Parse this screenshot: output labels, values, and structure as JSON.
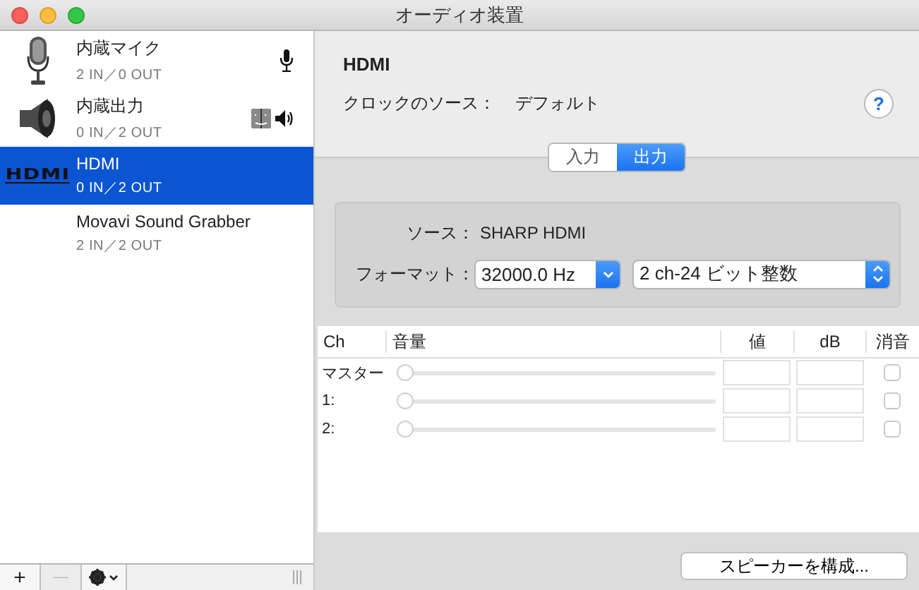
{
  "window": {
    "title": "オーディオ装置"
  },
  "devices": [
    {
      "kind": "microphone",
      "name": "内蔵マイク",
      "io": "2 IN／0 OUT",
      "selected": false,
      "default_input": true,
      "default_output": false,
      "system_output": false
    },
    {
      "kind": "speaker",
      "name": "内蔵出力",
      "io": "0 IN／2 OUT",
      "selected": false,
      "default_input": false,
      "default_output": true,
      "system_output": true
    },
    {
      "kind": "hdmi",
      "logo": "HDMI",
      "name": "HDMI",
      "io": "0 IN／2 OUT",
      "selected": true,
      "default_input": false,
      "default_output": false,
      "system_output": false
    },
    {
      "kind": "plain",
      "name": "Movavi Sound Grabber",
      "io": "2 IN／2 OUT",
      "selected": false,
      "default_input": false,
      "default_output": false,
      "system_output": false
    }
  ],
  "sidebar_toolbar": {
    "add": "+",
    "remove": "—",
    "remove_disabled": true
  },
  "detail": {
    "title": "HDMI",
    "clock_label": "クロックのソース：",
    "clock_value": "デフォルト",
    "help": "?"
  },
  "tabs": [
    {
      "label": "入力",
      "selected": false
    },
    {
      "label": "出力",
      "selected": true
    }
  ],
  "format_box": {
    "source_label": "ソース：",
    "source_value": "SHARP HDMI",
    "format_label": "フォーマット：",
    "rate": "32000.0 Hz",
    "format": "2 ch-24 ビット整数"
  },
  "table": {
    "columns": [
      "Ch",
      "音量",
      "値",
      "dB",
      "消音"
    ],
    "rows": [
      {
        "channel": "マスター",
        "level": 0,
        "muted": false
      },
      {
        "channel": "1:",
        "level": 0,
        "muted": false
      },
      {
        "channel": "2:",
        "level": 0,
        "muted": false
      }
    ]
  },
  "configure_button": "スピーカーを構成..."
}
